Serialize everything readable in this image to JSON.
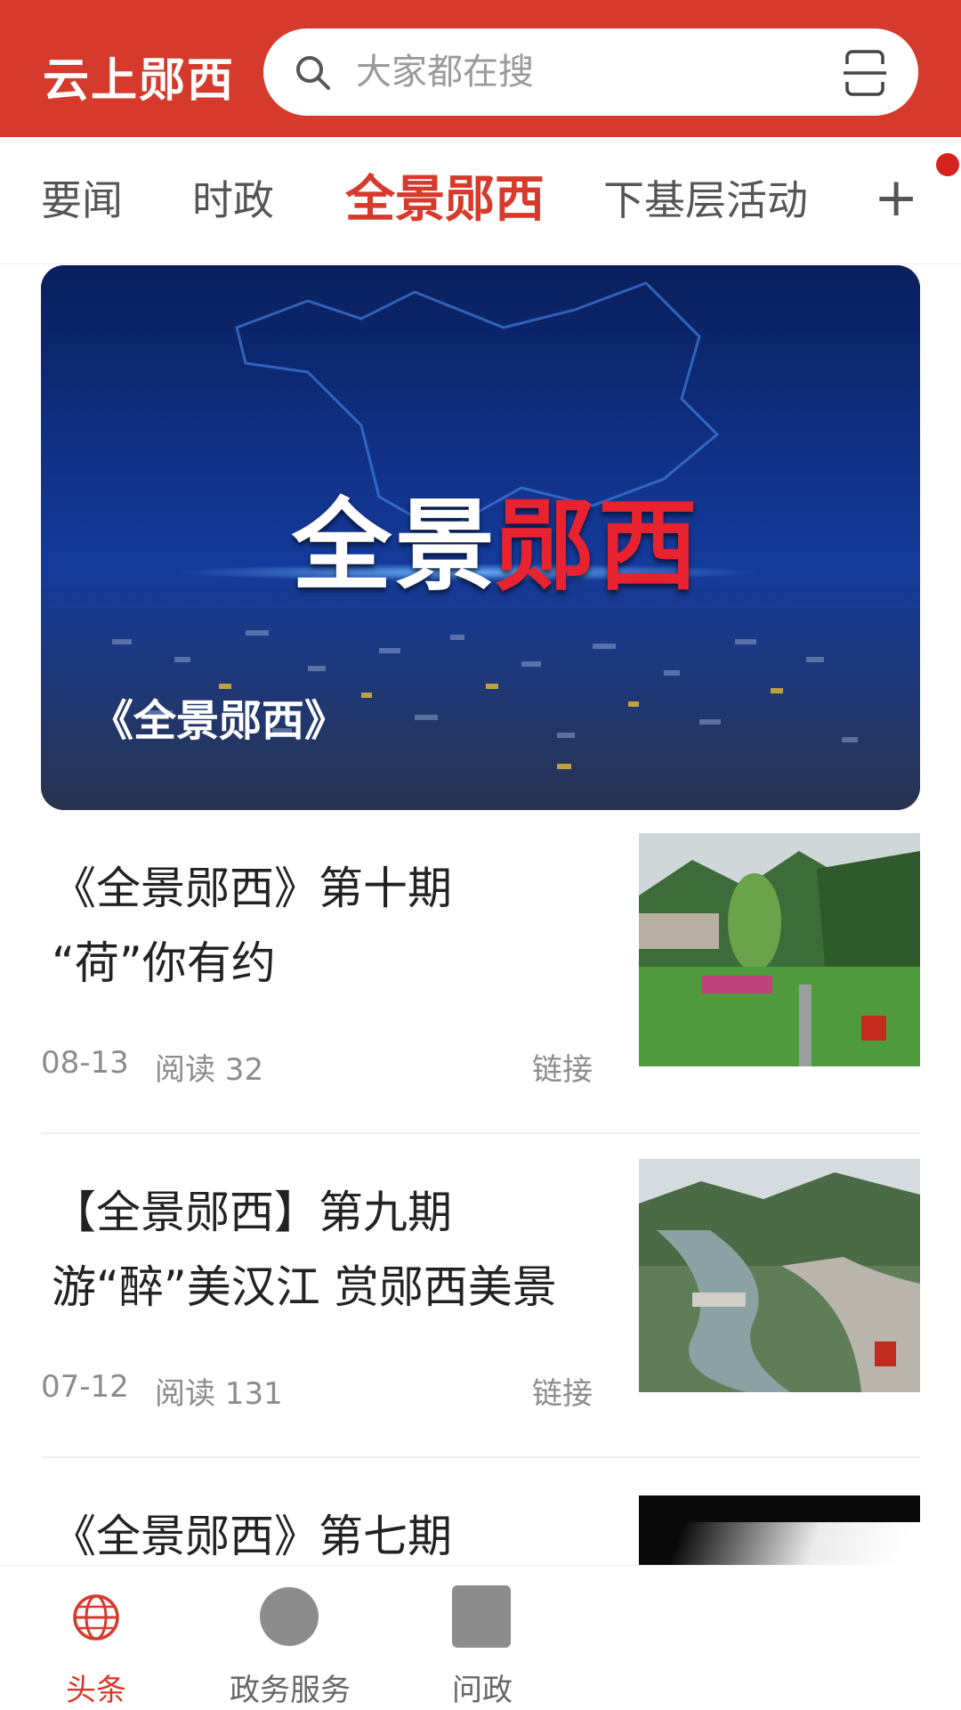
{
  "header": {
    "app_title": "云上郧西",
    "search_placeholder": "大家都在搜",
    "brand_color": "#d63a2c"
  },
  "tabs": [
    {
      "label": "要闻"
    },
    {
      "label": "时政"
    },
    {
      "label": "全景郧西",
      "active": true
    },
    {
      "label": "下基层活动"
    }
  ],
  "tabs_more": "+",
  "banner": {
    "title_part1": "全景",
    "title_part2": "郧西",
    "caption": "《全景郧西》"
  },
  "articles": [
    {
      "title_line1": "《全景郧西》第十期",
      "title_line2": "“荷”你有约",
      "date": "08-13",
      "reads": "阅读 32",
      "link": "链接"
    },
    {
      "title_line1": "【全景郧西】第九期",
      "title_line2": "游“醉”美汉江 赏郧西美景",
      "date": "07-12",
      "reads": "阅读 131",
      "link": "链接"
    },
    {
      "title_line1": "《全景郧西》第七期"
    }
  ],
  "bottom_nav": [
    {
      "label": "头条",
      "icon": "globe-icon",
      "active": true
    },
    {
      "label": "政务服务",
      "icon": "circle-icon"
    },
    {
      "label": "问政",
      "icon": "square-icon"
    }
  ]
}
